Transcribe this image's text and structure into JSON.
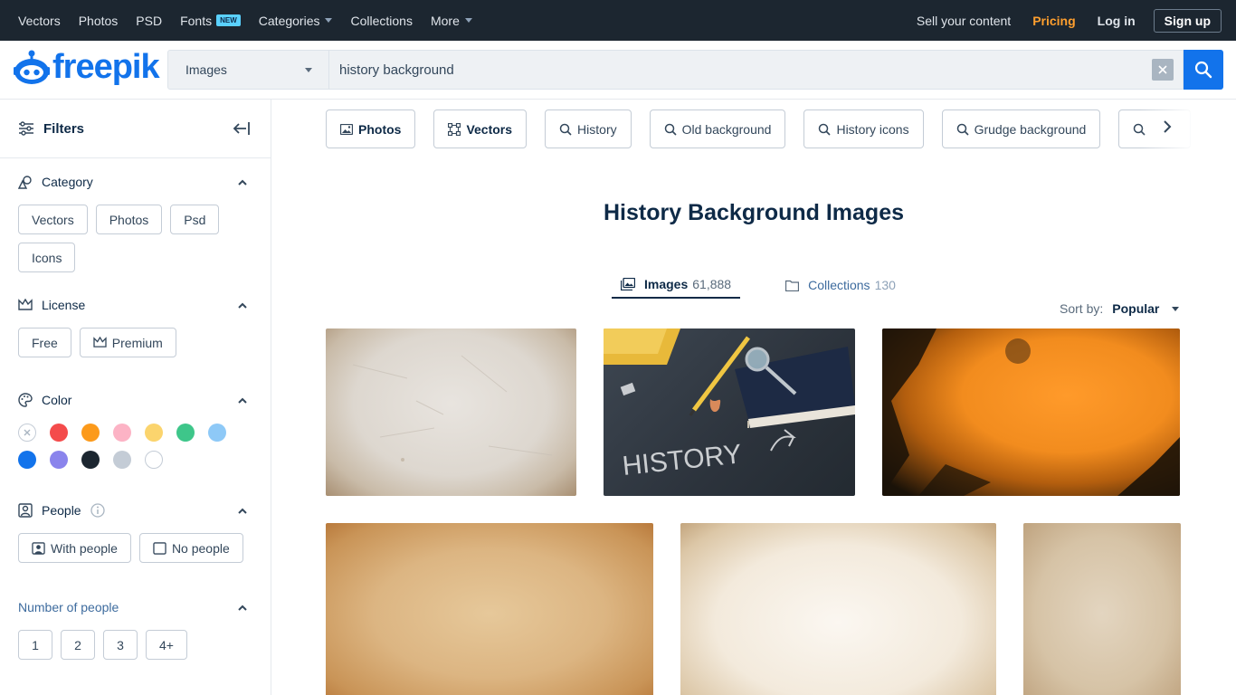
{
  "topnav": {
    "items": [
      "Vectors",
      "Photos",
      "PSD",
      "Fonts",
      "Categories",
      "Collections",
      "More"
    ],
    "fonts_badge": "NEW",
    "sell": "Sell your content",
    "pricing": "Pricing",
    "login": "Log in",
    "signup": "Sign up"
  },
  "brand": {
    "name": "freepik",
    "color": "#1273eb"
  },
  "search": {
    "type": "Images",
    "query": "history background"
  },
  "sidebar": {
    "title": "Filters",
    "category": {
      "label": "Category",
      "options": [
        "Vectors",
        "Photos",
        "Psd",
        "Icons"
      ]
    },
    "license": {
      "label": "License",
      "options": [
        "Free",
        "Premium"
      ]
    },
    "color": {
      "label": "Color",
      "swatches": [
        "none",
        "#f44b4b",
        "#fc9a1b",
        "#fcb3c5",
        "#fbd46d",
        "#3ec68a",
        "#8ec9f7",
        "#1273eb",
        "#8a84ec",
        "#1c2630",
        "#c4ccd6",
        "#ffffff"
      ]
    },
    "people": {
      "label": "People",
      "options": [
        "With people",
        "No people"
      ]
    },
    "number_of_people": {
      "label": "Number of people",
      "options": [
        "1",
        "2",
        "3",
        "4+"
      ]
    }
  },
  "suggestions": [
    "Photos",
    "Vectors",
    "History",
    "Old background",
    "History icons",
    "Grudge background"
  ],
  "page_title": "History Background Images",
  "tabs": [
    {
      "label": "Images",
      "count": "61,888"
    },
    {
      "label": "Collections",
      "count": "130"
    }
  ],
  "sort": {
    "label": "Sort by:",
    "value": "Popular"
  },
  "chalkboard_text": "HISTORY"
}
